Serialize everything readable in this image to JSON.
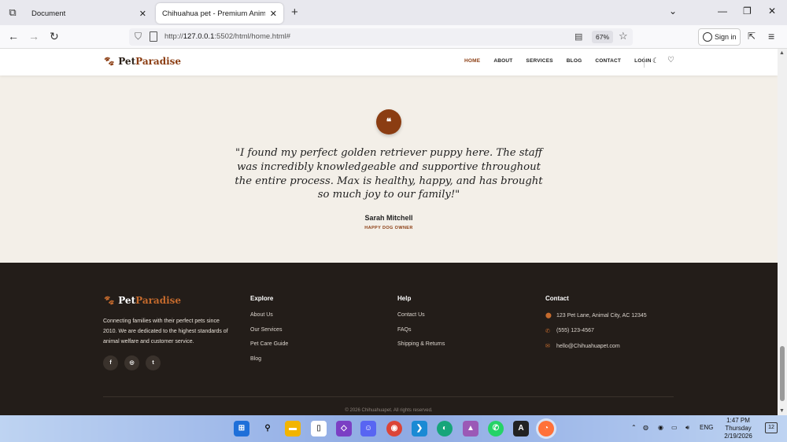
{
  "browser": {
    "tabs": [
      {
        "title": "Document",
        "active": false
      },
      {
        "title": "Chihuahua pet - Premium Animal St",
        "active": true
      }
    ],
    "url_prefix": "http://",
    "url_host": "127.0.0.1",
    "url_rest": ":5502/html/home.html#",
    "zoom": "67%",
    "signin_label": "Sign in"
  },
  "site": {
    "logo_part1": "Pet",
    "logo_part2": "Paradise",
    "nav": [
      "HOME",
      "ABOUT",
      "SERVICES",
      "BLOG",
      "CONTACT",
      "LOGIN"
    ],
    "testimonial": {
      "quote_mark": "❝",
      "text": "\"I found my perfect golden retriever puppy here. The staff was incredibly knowledgeable and supportive throughout the entire process. Max is healthy, happy, and has brought so much joy to our family!\"",
      "author": "Sarah Mitchell",
      "role": "HAPPY DOG OWNER"
    },
    "footer": {
      "description": "Connecting families with their perfect pets since 2010. We are dedicated to the highest standards of animal welfare and customer service.",
      "socials": [
        "f",
        "◎",
        "t"
      ],
      "explore_title": "Explore",
      "explore_links": [
        "About Us",
        "Our Services",
        "Pet Care Guide",
        "Blog"
      ],
      "help_title": "Help",
      "help_links": [
        "Contact Us",
        "FAQs",
        "Shipping & Returns"
      ],
      "contact_title": "Contact",
      "contact_items": [
        {
          "icon": "location-pin-icon",
          "text": "123 Pet Lane, Animal City, AC 12345"
        },
        {
          "icon": "phone-icon",
          "text": "(555) 123-4567"
        },
        {
          "icon": "envelope-icon",
          "text": "hello@Chihuahuapet.com"
        }
      ],
      "copyright": "© 2026 Chihuahuapet. All rights reserved."
    }
  },
  "taskbar": {
    "lang": "ENG",
    "time": "1:47 PM",
    "day": "Thursday",
    "date": "2/19/2026",
    "notifications": "12"
  },
  "colors": {
    "brand": "#8b3d12",
    "footer_bg": "#231d19",
    "section_bg": "#f3efe8"
  }
}
